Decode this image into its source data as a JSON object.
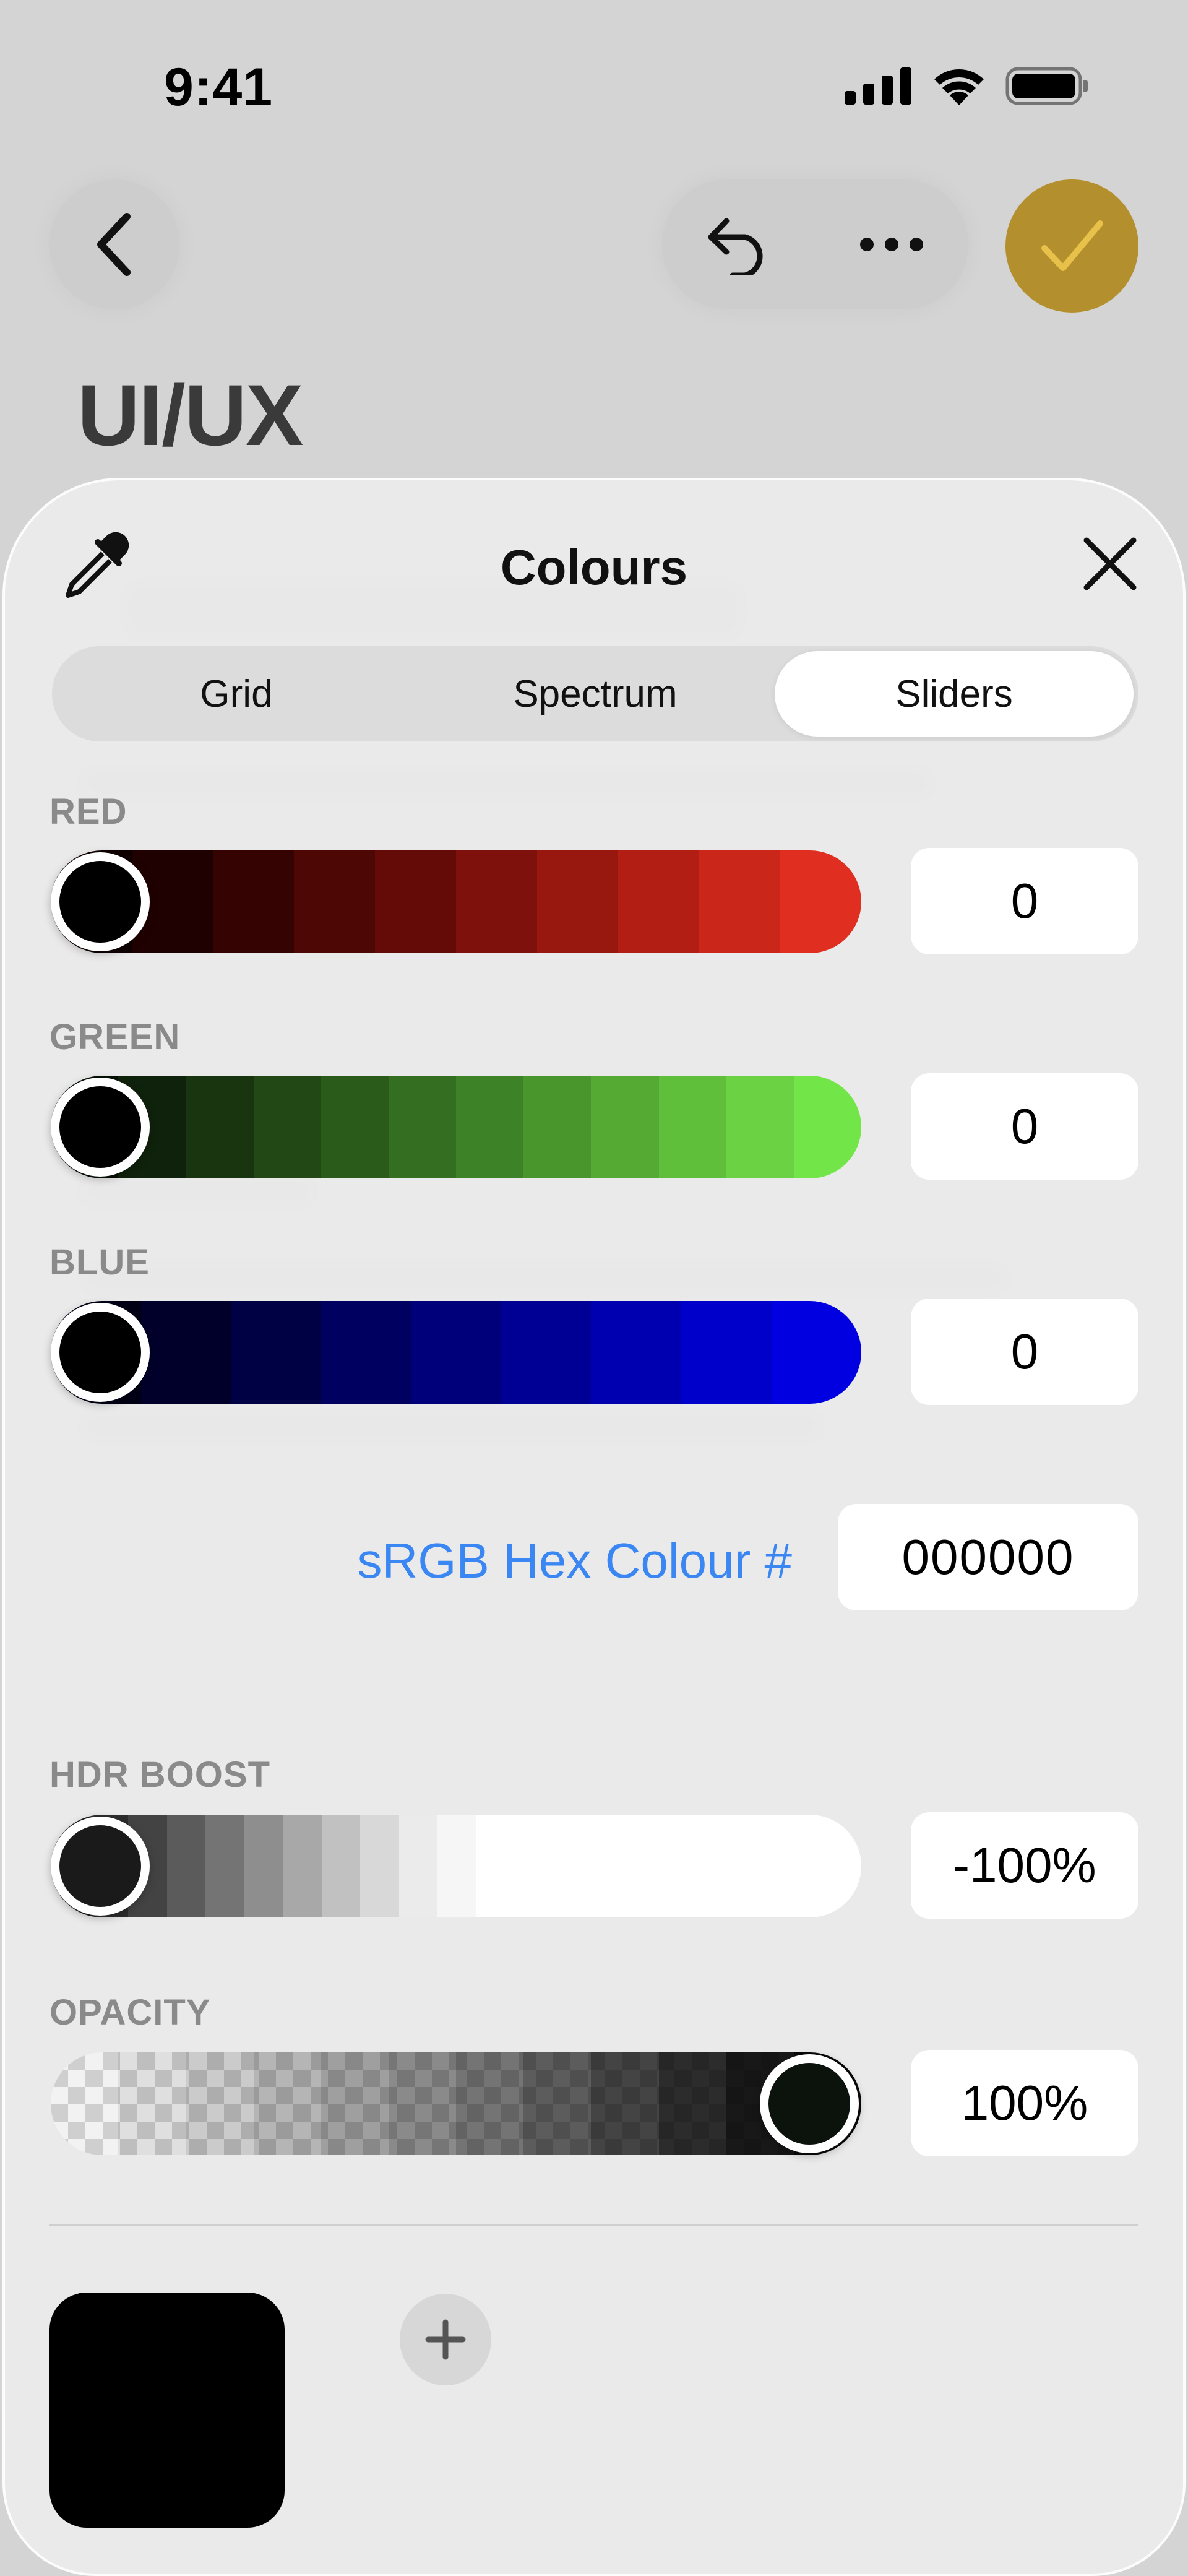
{
  "status": {
    "time": "9:41"
  },
  "nav": {
    "title": "UI/UX"
  },
  "sheet": {
    "title": "Colours",
    "tabs": [
      {
        "label": "Grid",
        "active": false
      },
      {
        "label": "Spectrum",
        "active": false
      },
      {
        "label": "Sliders",
        "active": true
      }
    ]
  },
  "sliders": {
    "red": {
      "label": "RED",
      "value": "0",
      "level": 0
    },
    "green": {
      "label": "GREEN",
      "value": "0",
      "level": 0
    },
    "blue": {
      "label": "BLUE",
      "value": "0",
      "level": 0
    },
    "hdr": {
      "label": "HDR BOOST",
      "value": "-100%",
      "level": 0
    },
    "opacity": {
      "label": "OPACITY",
      "value": "100%",
      "level": 1
    }
  },
  "hex": {
    "label": "sRGB Hex Colour #",
    "value": "000000"
  },
  "colors": {
    "accent_link": "#3a86f2",
    "done_button": "#b48f2e",
    "current_colour": "#000000"
  },
  "icons": {
    "back": "chevron-left-icon",
    "undo": "undo-icon",
    "more": "ellipsis-icon",
    "done": "checkmark-icon",
    "eyedropper": "eyedropper-icon",
    "close": "close-icon",
    "add": "plus-icon"
  }
}
